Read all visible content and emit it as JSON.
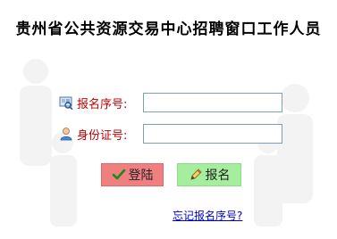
{
  "title": "贵州省公共资源交易中心招聘窗口工作人员",
  "form": {
    "serial_label": "报名序号:",
    "serial_value": "",
    "id_label": "身份证号:",
    "id_value": ""
  },
  "buttons": {
    "login_label": "登陆",
    "register_label": "报名"
  },
  "forgot_link": "忘记报名序号?",
  "icons": {
    "serial": "id-card-search-icon",
    "id": "user-icon",
    "login": "checkmark-icon",
    "register": "edit-pencil-icon"
  },
  "colors": {
    "label": "#c00000",
    "login_bg": "#f08080",
    "register_bg": "#a4ee9e",
    "link": "#0000cc"
  }
}
